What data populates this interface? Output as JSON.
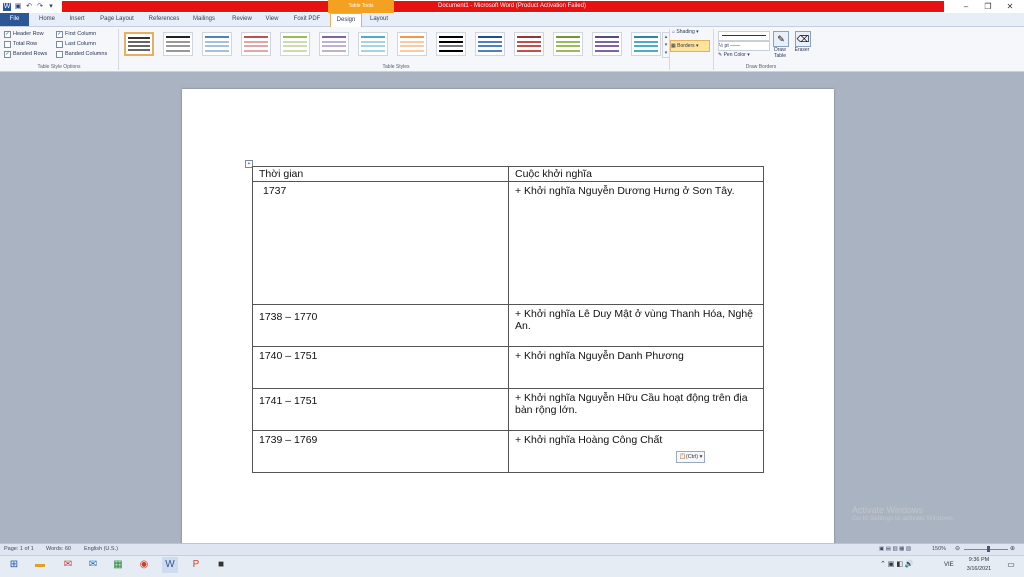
{
  "window": {
    "title": "Document1 - Microsoft Word (Product Activation Failed)",
    "contextual_group": "Table Tools"
  },
  "tabs": [
    "File",
    "Home",
    "Insert",
    "Page Layout",
    "References",
    "Mailings",
    "Review",
    "View",
    "Foxit PDF",
    "Design",
    "Layout"
  ],
  "ribbon": {
    "style_options": {
      "header_row": "Header Row",
      "total_row": "Total Row",
      "banded_rows": "Banded Rows",
      "first_column": "First Column",
      "last_column": "Last Column",
      "banded_columns": "Banded Columns",
      "group_label": "Table Style Options"
    },
    "table_styles_label": "Table Styles",
    "shading": "Shading",
    "borders": "Borders",
    "pen_weight": "½ pt",
    "pen_color": "Pen Color",
    "draw_table": "Draw Table",
    "eraser": "Eraser",
    "draw_borders_label": "Draw Borders"
  },
  "table": {
    "header": [
      "Thời gian",
      "Cuộc khởi nghĩa"
    ],
    "rows": [
      [
        "1737",
        "+ Khởi nghĩa Nguyễn Dương Hưng ở Sơn Tây."
      ],
      [
        "1738 – 1770",
        "+ Khởi nghĩa Lê Duy Mật ở vùng Thanh Hóa, Nghệ An."
      ],
      [
        "1740 – 1751",
        "+ Khởi nghĩa Nguyễn Danh Phương"
      ],
      [
        "1741 – 1751",
        "+ Khởi nghĩa Nguyễn Hữu Cầu hoạt động trên địa bàn rộng lớn."
      ],
      [
        "1739 – 1769",
        "+ Khởi nghĩa Hoàng Công Chất"
      ]
    ]
  },
  "paste_options": "(Ctrl)",
  "status": {
    "page": "Page: 1 of 1",
    "words": "Words: 60",
    "language": "English (U.S.)",
    "zoom": "150%"
  },
  "watermark": {
    "title": "Activate Windows",
    "subtitle": "Go to Settings to activate Windows."
  },
  "tray": {
    "lang": "VIE",
    "time": "9:36 PM",
    "date": "3/16/2021"
  }
}
